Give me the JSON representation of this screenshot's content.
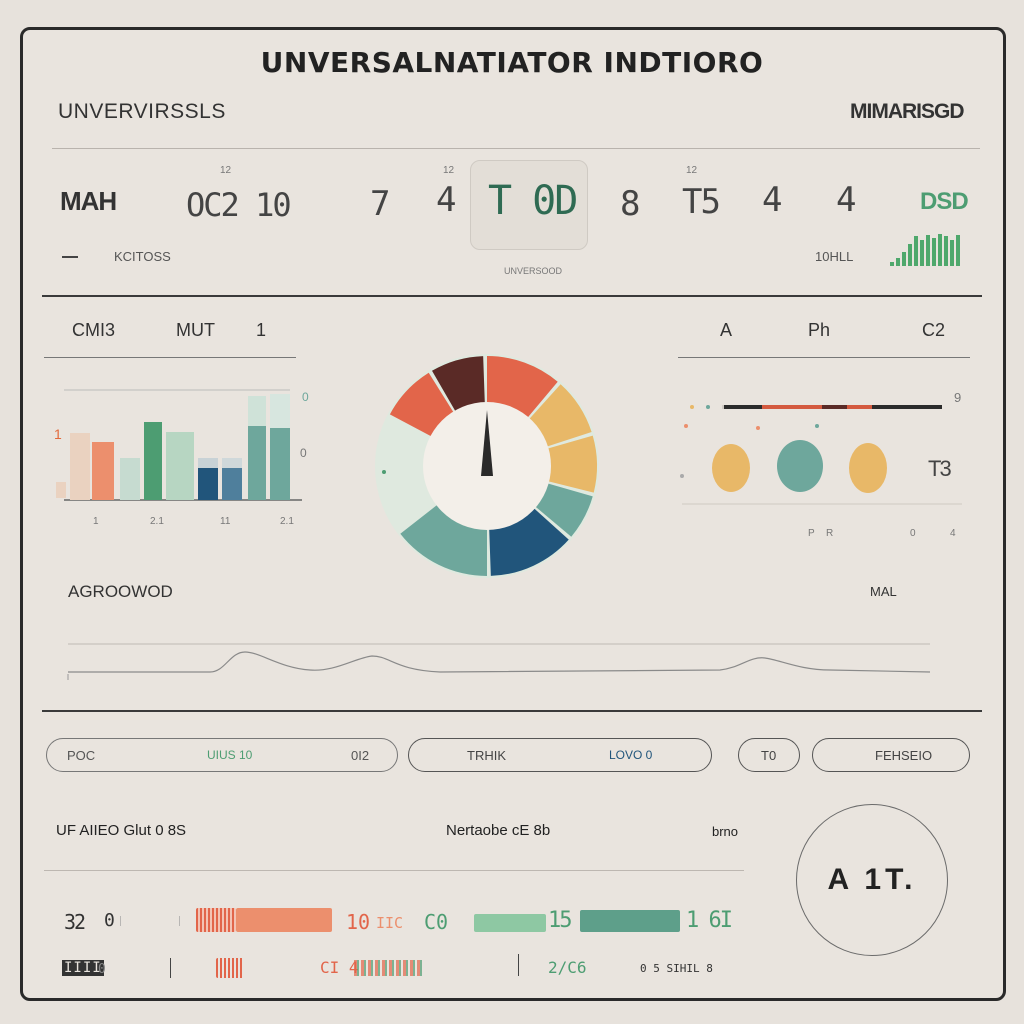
{
  "title": "UNVERSALNATIATOR INDTIORO",
  "header": {
    "left": "UNVERVIRSSLS",
    "right": "MIMARISGD"
  },
  "top_row": {
    "left_label": "MAH",
    "left_value": "OC2 10",
    "small_marks": [
      "12",
      "12",
      "12"
    ],
    "digits": [
      "7",
      "4",
      "8",
      "T5",
      "4",
      "4"
    ],
    "focus_value": "T 0D",
    "focus_caption": "UNVERSOOD",
    "right_value": "DSD",
    "left_sub": "KCITOSS",
    "right_sub": "10HLL"
  },
  "left_panel": {
    "labels": [
      "CMI3",
      "MUT",
      "1"
    ],
    "axis_left": "1",
    "axis_right": [
      "0",
      "0"
    ],
    "x_labels": [
      "1",
      "2.1",
      "11",
      "2.1"
    ]
  },
  "right_panel": {
    "labels": [
      "A",
      "Ph",
      "C2"
    ],
    "value": "T3",
    "right_top": "9",
    "x_labels": [
      "P",
      "R",
      "0",
      "4"
    ]
  },
  "wave": {
    "label": "AGROOWOD",
    "right": "MAL"
  },
  "pills": [
    {
      "left": "POC",
      "mid": "UIUS 10",
      "right": "0I2"
    },
    {
      "left": "TRHIK",
      "mid": "LOVO 0"
    },
    {
      "left": "T0"
    },
    {
      "left": "FEHSEIO"
    }
  ],
  "status": {
    "left": "UF  AIIEO  Glut  0 8S",
    "mid": "Nertaobe  cE  8b",
    "right": "brno",
    "circle": "A 1T."
  },
  "footer": {
    "row1": [
      "32",
      "0",
      "10",
      "IIC",
      "C0",
      "15",
      "1 6I"
    ],
    "row2": [
      "IIII",
      "0",
      "CI 4",
      "2/C6",
      "0 5 SIHIL 8"
    ]
  },
  "colors": {
    "red": "#e2654a",
    "salmon": "#ec8f6d",
    "teal": "#6ea79c",
    "green": "#4d9d72",
    "navy": "#21557b",
    "mustard": "#e8b868",
    "maroon": "#5a2a26"
  }
}
